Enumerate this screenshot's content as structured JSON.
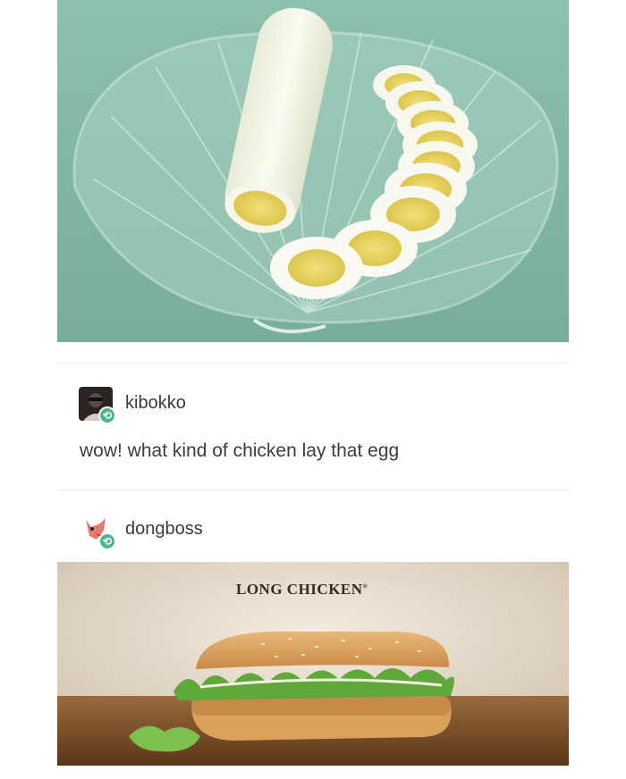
{
  "posts": [
    {
      "username": "kibokko",
      "text": "wow! what kind of chicken lay that egg",
      "avatar_icon": "dark-portrait-avatar",
      "badge_icon": "reblog-icon"
    },
    {
      "username": "dongboss",
      "avatar_icon": "cartoon-fox-avatar",
      "badge_icon": "reblog-icon"
    }
  ],
  "images": {
    "top_photo": "long-egg-on-glass-shell-plate",
    "bottom_photo": "long-chicken-sandwich-ad",
    "bottom_banner_text": "LONG CHICKEN",
    "bottom_banner_mark": "®"
  },
  "colors": {
    "egg_background": "#7fb3a2",
    "reblog_badge": "#4bb88a",
    "text": "#3d3d3d"
  }
}
